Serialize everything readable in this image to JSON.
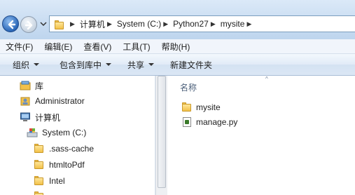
{
  "address": {
    "crumbs": [
      "计算机",
      "System (C:)",
      "Python27",
      "mysite"
    ]
  },
  "menu": [
    "文件(F)",
    "编辑(E)",
    "查看(V)",
    "工具(T)",
    "帮助(H)"
  ],
  "toolbar": {
    "organize": "组织",
    "include": "包含到库中",
    "share": "共享",
    "new_folder": "新建文件夹"
  },
  "nav": {
    "library": "库",
    "administrator": "Administrator",
    "computer": "计算机",
    "system_c": "System (C:)",
    "folders": [
      ".sass-cache",
      "htmltoPdf",
      "Intel"
    ]
  },
  "content": {
    "column_name": "名称",
    "files": [
      {
        "name": "mysite",
        "type": "folder"
      },
      {
        "name": "manage.py",
        "type": "python-file"
      }
    ]
  }
}
